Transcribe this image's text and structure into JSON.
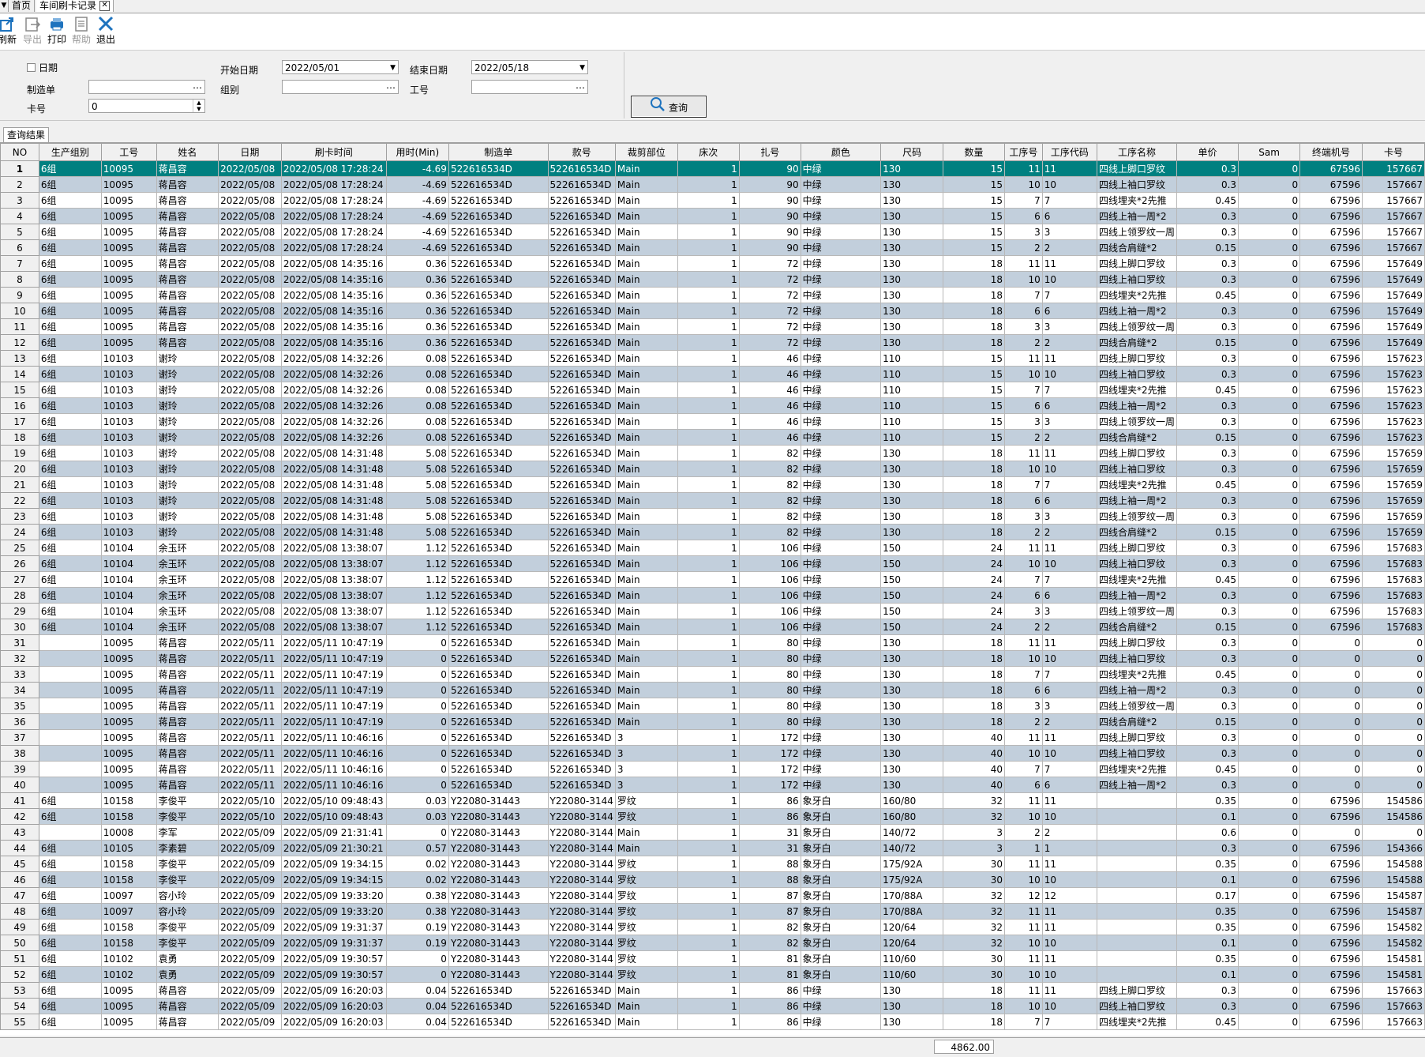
{
  "tabs": [
    {
      "label": "首页"
    },
    {
      "label": "车间刷卡记录"
    }
  ],
  "toolbar": {
    "refresh": "刷新",
    "export": "导出",
    "print": "打印",
    "help": "帮助",
    "exit": "退出"
  },
  "query": {
    "date_check_label": "日期",
    "start_date_label": "开始日期",
    "start_date_value": "2022/05/01",
    "end_date_label": "结束日期",
    "end_date_value": "2022/05/18",
    "order_label": "制造单",
    "order_value": "",
    "group_label": "组别",
    "group_value": "",
    "worker_label": "工号",
    "worker_value": "",
    "card_label": "卡号",
    "card_value": "0",
    "search_button": "查询"
  },
  "results_tab": "查询结果",
  "columns": [
    "NO",
    "生产组别",
    "工号",
    "姓名",
    "日期",
    "刷卡时间",
    "用时(Min)",
    "制造单",
    "款号",
    "裁剪部位",
    "床次",
    "扎号",
    "颜色",
    "尺码",
    "数量",
    "工序号",
    "工序代码",
    "工序名称",
    "单价",
    "Sam",
    "终端机号",
    "卡号"
  ],
  "rows": [
    [
      "1",
      "6组",
      "10095",
      "蒋昌容",
      "2022/05/08",
      "2022/05/08 17:28:24",
      "-4.69",
      "522616534D",
      "522616534D",
      "Main",
      "1",
      "90",
      "中绿",
      "130",
      "15",
      "11",
      "11",
      "四线上脚口罗纹",
      "0.3",
      "0",
      "67596",
      "157667"
    ],
    [
      "2",
      "6组",
      "10095",
      "蒋昌容",
      "2022/05/08",
      "2022/05/08 17:28:24",
      "-4.69",
      "522616534D",
      "522616534D",
      "Main",
      "1",
      "90",
      "中绿",
      "130",
      "15",
      "10",
      "10",
      "四线上袖口罗纹",
      "0.3",
      "0",
      "67596",
      "157667"
    ],
    [
      "3",
      "6组",
      "10095",
      "蒋昌容",
      "2022/05/08",
      "2022/05/08 17:28:24",
      "-4.69",
      "522616534D",
      "522616534D",
      "Main",
      "1",
      "90",
      "中绿",
      "130",
      "15",
      "7",
      "7",
      "四线埋夹*2先推",
      "0.45",
      "0",
      "67596",
      "157667"
    ],
    [
      "4",
      "6组",
      "10095",
      "蒋昌容",
      "2022/05/08",
      "2022/05/08 17:28:24",
      "-4.69",
      "522616534D",
      "522616534D",
      "Main",
      "1",
      "90",
      "中绿",
      "130",
      "15",
      "6",
      "6",
      "四线上袖一周*2",
      "0.3",
      "0",
      "67596",
      "157667"
    ],
    [
      "5",
      "6组",
      "10095",
      "蒋昌容",
      "2022/05/08",
      "2022/05/08 17:28:24",
      "-4.69",
      "522616534D",
      "522616534D",
      "Main",
      "1",
      "90",
      "中绿",
      "130",
      "15",
      "3",
      "3",
      "四线上领罗纹一周",
      "0.3",
      "0",
      "67596",
      "157667"
    ],
    [
      "6",
      "6组",
      "10095",
      "蒋昌容",
      "2022/05/08",
      "2022/05/08 17:28:24",
      "-4.69",
      "522616534D",
      "522616534D",
      "Main",
      "1",
      "90",
      "中绿",
      "130",
      "15",
      "2",
      "2",
      "四线合肩缝*2",
      "0.15",
      "0",
      "67596",
      "157667"
    ],
    [
      "7",
      "6组",
      "10095",
      "蒋昌容",
      "2022/05/08",
      "2022/05/08 14:35:16",
      "0.36",
      "522616534D",
      "522616534D",
      "Main",
      "1",
      "72",
      "中绿",
      "130",
      "18",
      "11",
      "11",
      "四线上脚口罗纹",
      "0.3",
      "0",
      "67596",
      "157649"
    ],
    [
      "8",
      "6组",
      "10095",
      "蒋昌容",
      "2022/05/08",
      "2022/05/08 14:35:16",
      "0.36",
      "522616534D",
      "522616534D",
      "Main",
      "1",
      "72",
      "中绿",
      "130",
      "18",
      "10",
      "10",
      "四线上袖口罗纹",
      "0.3",
      "0",
      "67596",
      "157649"
    ],
    [
      "9",
      "6组",
      "10095",
      "蒋昌容",
      "2022/05/08",
      "2022/05/08 14:35:16",
      "0.36",
      "522616534D",
      "522616534D",
      "Main",
      "1",
      "72",
      "中绿",
      "130",
      "18",
      "7",
      "7",
      "四线埋夹*2先推",
      "0.45",
      "0",
      "67596",
      "157649"
    ],
    [
      "10",
      "6组",
      "10095",
      "蒋昌容",
      "2022/05/08",
      "2022/05/08 14:35:16",
      "0.36",
      "522616534D",
      "522616534D",
      "Main",
      "1",
      "72",
      "中绿",
      "130",
      "18",
      "6",
      "6",
      "四线上袖一周*2",
      "0.3",
      "0",
      "67596",
      "157649"
    ],
    [
      "11",
      "6组",
      "10095",
      "蒋昌容",
      "2022/05/08",
      "2022/05/08 14:35:16",
      "0.36",
      "522616534D",
      "522616534D",
      "Main",
      "1",
      "72",
      "中绿",
      "130",
      "18",
      "3",
      "3",
      "四线上领罗纹一周",
      "0.3",
      "0",
      "67596",
      "157649"
    ],
    [
      "12",
      "6组",
      "10095",
      "蒋昌容",
      "2022/05/08",
      "2022/05/08 14:35:16",
      "0.36",
      "522616534D",
      "522616534D",
      "Main",
      "1",
      "72",
      "中绿",
      "130",
      "18",
      "2",
      "2",
      "四线合肩缝*2",
      "0.15",
      "0",
      "67596",
      "157649"
    ],
    [
      "13",
      "6组",
      "10103",
      "谢玲",
      "2022/05/08",
      "2022/05/08 14:32:26",
      "0.08",
      "522616534D",
      "522616534D",
      "Main",
      "1",
      "46",
      "中绿",
      "110",
      "15",
      "11",
      "11",
      "四线上脚口罗纹",
      "0.3",
      "0",
      "67596",
      "157623"
    ],
    [
      "14",
      "6组",
      "10103",
      "谢玲",
      "2022/05/08",
      "2022/05/08 14:32:26",
      "0.08",
      "522616534D",
      "522616534D",
      "Main",
      "1",
      "46",
      "中绿",
      "110",
      "15",
      "10",
      "10",
      "四线上袖口罗纹",
      "0.3",
      "0",
      "67596",
      "157623"
    ],
    [
      "15",
      "6组",
      "10103",
      "谢玲",
      "2022/05/08",
      "2022/05/08 14:32:26",
      "0.08",
      "522616534D",
      "522616534D",
      "Main",
      "1",
      "46",
      "中绿",
      "110",
      "15",
      "7",
      "7",
      "四线埋夹*2先推",
      "0.45",
      "0",
      "67596",
      "157623"
    ],
    [
      "16",
      "6组",
      "10103",
      "谢玲",
      "2022/05/08",
      "2022/05/08 14:32:26",
      "0.08",
      "522616534D",
      "522616534D",
      "Main",
      "1",
      "46",
      "中绿",
      "110",
      "15",
      "6",
      "6",
      "四线上袖一周*2",
      "0.3",
      "0",
      "67596",
      "157623"
    ],
    [
      "17",
      "6组",
      "10103",
      "谢玲",
      "2022/05/08",
      "2022/05/08 14:32:26",
      "0.08",
      "522616534D",
      "522616534D",
      "Main",
      "1",
      "46",
      "中绿",
      "110",
      "15",
      "3",
      "3",
      "四线上领罗纹一周",
      "0.3",
      "0",
      "67596",
      "157623"
    ],
    [
      "18",
      "6组",
      "10103",
      "谢玲",
      "2022/05/08",
      "2022/05/08 14:32:26",
      "0.08",
      "522616534D",
      "522616534D",
      "Main",
      "1",
      "46",
      "中绿",
      "110",
      "15",
      "2",
      "2",
      "四线合肩缝*2",
      "0.15",
      "0",
      "67596",
      "157623"
    ],
    [
      "19",
      "6组",
      "10103",
      "谢玲",
      "2022/05/08",
      "2022/05/08 14:31:48",
      "5.08",
      "522616534D",
      "522616534D",
      "Main",
      "1",
      "82",
      "中绿",
      "130",
      "18",
      "11",
      "11",
      "四线上脚口罗纹",
      "0.3",
      "0",
      "67596",
      "157659"
    ],
    [
      "20",
      "6组",
      "10103",
      "谢玲",
      "2022/05/08",
      "2022/05/08 14:31:48",
      "5.08",
      "522616534D",
      "522616534D",
      "Main",
      "1",
      "82",
      "中绿",
      "130",
      "18",
      "10",
      "10",
      "四线上袖口罗纹",
      "0.3",
      "0",
      "67596",
      "157659"
    ],
    [
      "21",
      "6组",
      "10103",
      "谢玲",
      "2022/05/08",
      "2022/05/08 14:31:48",
      "5.08",
      "522616534D",
      "522616534D",
      "Main",
      "1",
      "82",
      "中绿",
      "130",
      "18",
      "7",
      "7",
      "四线埋夹*2先推",
      "0.45",
      "0",
      "67596",
      "157659"
    ],
    [
      "22",
      "6组",
      "10103",
      "谢玲",
      "2022/05/08",
      "2022/05/08 14:31:48",
      "5.08",
      "522616534D",
      "522616534D",
      "Main",
      "1",
      "82",
      "中绿",
      "130",
      "18",
      "6",
      "6",
      "四线上袖一周*2",
      "0.3",
      "0",
      "67596",
      "157659"
    ],
    [
      "23",
      "6组",
      "10103",
      "谢玲",
      "2022/05/08",
      "2022/05/08 14:31:48",
      "5.08",
      "522616534D",
      "522616534D",
      "Main",
      "1",
      "82",
      "中绿",
      "130",
      "18",
      "3",
      "3",
      "四线上领罗纹一周",
      "0.3",
      "0",
      "67596",
      "157659"
    ],
    [
      "24",
      "6组",
      "10103",
      "谢玲",
      "2022/05/08",
      "2022/05/08 14:31:48",
      "5.08",
      "522616534D",
      "522616534D",
      "Main",
      "1",
      "82",
      "中绿",
      "130",
      "18",
      "2",
      "2",
      "四线合肩缝*2",
      "0.15",
      "0",
      "67596",
      "157659"
    ],
    [
      "25",
      "6组",
      "10104",
      "余玉环",
      "2022/05/08",
      "2022/05/08 13:38:07",
      "1.12",
      "522616534D",
      "522616534D",
      "Main",
      "1",
      "106",
      "中绿",
      "150",
      "24",
      "11",
      "11",
      "四线上脚口罗纹",
      "0.3",
      "0",
      "67596",
      "157683"
    ],
    [
      "26",
      "6组",
      "10104",
      "余玉环",
      "2022/05/08",
      "2022/05/08 13:38:07",
      "1.12",
      "522616534D",
      "522616534D",
      "Main",
      "1",
      "106",
      "中绿",
      "150",
      "24",
      "10",
      "10",
      "四线上袖口罗纹",
      "0.3",
      "0",
      "67596",
      "157683"
    ],
    [
      "27",
      "6组",
      "10104",
      "余玉环",
      "2022/05/08",
      "2022/05/08 13:38:07",
      "1.12",
      "522616534D",
      "522616534D",
      "Main",
      "1",
      "106",
      "中绿",
      "150",
      "24",
      "7",
      "7",
      "四线埋夹*2先推",
      "0.45",
      "0",
      "67596",
      "157683"
    ],
    [
      "28",
      "6组",
      "10104",
      "余玉环",
      "2022/05/08",
      "2022/05/08 13:38:07",
      "1.12",
      "522616534D",
      "522616534D",
      "Main",
      "1",
      "106",
      "中绿",
      "150",
      "24",
      "6",
      "6",
      "四线上袖一周*2",
      "0.3",
      "0",
      "67596",
      "157683"
    ],
    [
      "29",
      "6组",
      "10104",
      "余玉环",
      "2022/05/08",
      "2022/05/08 13:38:07",
      "1.12",
      "522616534D",
      "522616534D",
      "Main",
      "1",
      "106",
      "中绿",
      "150",
      "24",
      "3",
      "3",
      "四线上领罗纹一周",
      "0.3",
      "0",
      "67596",
      "157683"
    ],
    [
      "30",
      "6组",
      "10104",
      "余玉环",
      "2022/05/08",
      "2022/05/08 13:38:07",
      "1.12",
      "522616534D",
      "522616534D",
      "Main",
      "1",
      "106",
      "中绿",
      "150",
      "24",
      "2",
      "2",
      "四线合肩缝*2",
      "0.15",
      "0",
      "67596",
      "157683"
    ],
    [
      "31",
      "",
      "10095",
      "蒋昌容",
      "2022/05/11",
      "2022/05/11 10:47:19",
      "0",
      "522616534D",
      "522616534D",
      "Main",
      "1",
      "80",
      "中绿",
      "130",
      "18",
      "11",
      "11",
      "四线上脚口罗纹",
      "0.3",
      "0",
      "0",
      "0"
    ],
    [
      "32",
      "",
      "10095",
      "蒋昌容",
      "2022/05/11",
      "2022/05/11 10:47:19",
      "0",
      "522616534D",
      "522616534D",
      "Main",
      "1",
      "80",
      "中绿",
      "130",
      "18",
      "10",
      "10",
      "四线上袖口罗纹",
      "0.3",
      "0",
      "0",
      "0"
    ],
    [
      "33",
      "",
      "10095",
      "蒋昌容",
      "2022/05/11",
      "2022/05/11 10:47:19",
      "0",
      "522616534D",
      "522616534D",
      "Main",
      "1",
      "80",
      "中绿",
      "130",
      "18",
      "7",
      "7",
      "四线埋夹*2先推",
      "0.45",
      "0",
      "0",
      "0"
    ],
    [
      "34",
      "",
      "10095",
      "蒋昌容",
      "2022/05/11",
      "2022/05/11 10:47:19",
      "0",
      "522616534D",
      "522616534D",
      "Main",
      "1",
      "80",
      "中绿",
      "130",
      "18",
      "6",
      "6",
      "四线上袖一周*2",
      "0.3",
      "0",
      "0",
      "0"
    ],
    [
      "35",
      "",
      "10095",
      "蒋昌容",
      "2022/05/11",
      "2022/05/11 10:47:19",
      "0",
      "522616534D",
      "522616534D",
      "Main",
      "1",
      "80",
      "中绿",
      "130",
      "18",
      "3",
      "3",
      "四线上领罗纹一周",
      "0.3",
      "0",
      "0",
      "0"
    ],
    [
      "36",
      "",
      "10095",
      "蒋昌容",
      "2022/05/11",
      "2022/05/11 10:47:19",
      "0",
      "522616534D",
      "522616534D",
      "Main",
      "1",
      "80",
      "中绿",
      "130",
      "18",
      "2",
      "2",
      "四线合肩缝*2",
      "0.15",
      "0",
      "0",
      "0"
    ],
    [
      "37",
      "",
      "10095",
      "蒋昌容",
      "2022/05/11",
      "2022/05/11 10:46:16",
      "0",
      "522616534D",
      "522616534D",
      "3",
      "1",
      "172",
      "中绿",
      "130",
      "40",
      "11",
      "11",
      "四线上脚口罗纹",
      "0.3",
      "0",
      "0",
      "0"
    ],
    [
      "38",
      "",
      "10095",
      "蒋昌容",
      "2022/05/11",
      "2022/05/11 10:46:16",
      "0",
      "522616534D",
      "522616534D",
      "3",
      "1",
      "172",
      "中绿",
      "130",
      "40",
      "10",
      "10",
      "四线上袖口罗纹",
      "0.3",
      "0",
      "0",
      "0"
    ],
    [
      "39",
      "",
      "10095",
      "蒋昌容",
      "2022/05/11",
      "2022/05/11 10:46:16",
      "0",
      "522616534D",
      "522616534D",
      "3",
      "1",
      "172",
      "中绿",
      "130",
      "40",
      "7",
      "7",
      "四线埋夹*2先推",
      "0.45",
      "0",
      "0",
      "0"
    ],
    [
      "40",
      "",
      "10095",
      "蒋昌容",
      "2022/05/11",
      "2022/05/11 10:46:16",
      "0",
      "522616534D",
      "522616534D",
      "3",
      "1",
      "172",
      "中绿",
      "130",
      "40",
      "6",
      "6",
      "四线上袖一周*2",
      "0.3",
      "0",
      "0",
      "0"
    ],
    [
      "41",
      "6组",
      "10158",
      "李俊平",
      "2022/05/10",
      "2022/05/10 09:48:43",
      "0.03",
      "Y22080-31443",
      "Y22080-3144",
      "罗纹",
      "1",
      "86",
      "象牙白",
      "160/80",
      "32",
      "11",
      "11",
      "",
      "0.35",
      "0",
      "67596",
      "154586"
    ],
    [
      "42",
      "6组",
      "10158",
      "李俊平",
      "2022/05/10",
      "2022/05/10 09:48:43",
      "0.03",
      "Y22080-31443",
      "Y22080-3144",
      "罗纹",
      "1",
      "86",
      "象牙白",
      "160/80",
      "32",
      "10",
      "10",
      "",
      "0.1",
      "0",
      "67596",
      "154586"
    ],
    [
      "43",
      "",
      "10008",
      "李军",
      "2022/05/09",
      "2022/05/09 21:31:41",
      "0",
      "Y22080-31443",
      "Y22080-3144",
      "Main",
      "1",
      "31",
      "象牙白",
      "140/72",
      "3",
      "2",
      "2",
      "",
      "0.6",
      "0",
      "0",
      "0"
    ],
    [
      "44",
      "6组",
      "10105",
      "李素碧",
      "2022/05/09",
      "2022/05/09 21:30:21",
      "0.57",
      "Y22080-31443",
      "Y22080-3144",
      "Main",
      "1",
      "31",
      "象牙白",
      "140/72",
      "3",
      "1",
      "1",
      "",
      "0.3",
      "0",
      "67596",
      "154366"
    ],
    [
      "45",
      "6组",
      "10158",
      "李俊平",
      "2022/05/09",
      "2022/05/09 19:34:15",
      "0.02",
      "Y22080-31443",
      "Y22080-3144",
      "罗纹",
      "1",
      "88",
      "象牙白",
      "175/92A",
      "30",
      "11",
      "11",
      "",
      "0.35",
      "0",
      "67596",
      "154588"
    ],
    [
      "46",
      "6组",
      "10158",
      "李俊平",
      "2022/05/09",
      "2022/05/09 19:34:15",
      "0.02",
      "Y22080-31443",
      "Y22080-3144",
      "罗纹",
      "1",
      "88",
      "象牙白",
      "175/92A",
      "30",
      "10",
      "10",
      "",
      "0.1",
      "0",
      "67596",
      "154588"
    ],
    [
      "47",
      "6组",
      "10097",
      "容小玲",
      "2022/05/09",
      "2022/05/09 19:33:20",
      "0.38",
      "Y22080-31443",
      "Y22080-3144",
      "罗纹",
      "1",
      "87",
      "象牙白",
      "170/88A",
      "32",
      "12",
      "12",
      "",
      "0.17",
      "0",
      "67596",
      "154587"
    ],
    [
      "48",
      "6组",
      "10097",
      "容小玲",
      "2022/05/09",
      "2022/05/09 19:33:20",
      "0.38",
      "Y22080-31443",
      "Y22080-3144",
      "罗纹",
      "1",
      "87",
      "象牙白",
      "170/88A",
      "32",
      "11",
      "11",
      "",
      "0.35",
      "0",
      "67596",
      "154587"
    ],
    [
      "49",
      "6组",
      "10158",
      "李俊平",
      "2022/05/09",
      "2022/05/09 19:31:37",
      "0.19",
      "Y22080-31443",
      "Y22080-3144",
      "罗纹",
      "1",
      "82",
      "象牙白",
      "120/64",
      "32",
      "11",
      "11",
      "",
      "0.35",
      "0",
      "67596",
      "154582"
    ],
    [
      "50",
      "6组",
      "10158",
      "李俊平",
      "2022/05/09",
      "2022/05/09 19:31:37",
      "0.19",
      "Y22080-31443",
      "Y22080-3144",
      "罗纹",
      "1",
      "82",
      "象牙白",
      "120/64",
      "32",
      "10",
      "10",
      "",
      "0.1",
      "0",
      "67596",
      "154582"
    ],
    [
      "51",
      "6组",
      "10102",
      "袁勇",
      "2022/05/09",
      "2022/05/09 19:30:57",
      "0",
      "Y22080-31443",
      "Y22080-3144",
      "罗纹",
      "1",
      "81",
      "象牙白",
      "110/60",
      "30",
      "11",
      "11",
      "",
      "0.35",
      "0",
      "67596",
      "154581"
    ],
    [
      "52",
      "6组",
      "10102",
      "袁勇",
      "2022/05/09",
      "2022/05/09 19:30:57",
      "0",
      "Y22080-31443",
      "Y22080-3144",
      "罗纹",
      "1",
      "81",
      "象牙白",
      "110/60",
      "30",
      "10",
      "10",
      "",
      "0.1",
      "0",
      "67596",
      "154581"
    ],
    [
      "53",
      "6组",
      "10095",
      "蒋昌容",
      "2022/05/09",
      "2022/05/09 16:20:03",
      "0.04",
      "522616534D",
      "522616534D",
      "Main",
      "1",
      "86",
      "中绿",
      "130",
      "18",
      "11",
      "11",
      "四线上脚口罗纹",
      "0.3",
      "0",
      "67596",
      "157663"
    ],
    [
      "54",
      "6组",
      "10095",
      "蒋昌容",
      "2022/05/09",
      "2022/05/09 16:20:03",
      "0.04",
      "522616534D",
      "522616534D",
      "Main",
      "1",
      "86",
      "中绿",
      "130",
      "18",
      "10",
      "10",
      "四线上袖口罗纹",
      "0.3",
      "0",
      "67596",
      "157663"
    ],
    [
      "55",
      "6组",
      "10095",
      "蒋昌容",
      "2022/05/09",
      "2022/05/09 16:20:03",
      "0.04",
      "522616534D",
      "522616534D",
      "Main",
      "1",
      "86",
      "中绿",
      "130",
      "18",
      "7",
      "7",
      "四线埋夹*2先推",
      "0.45",
      "0",
      "67596",
      "157663"
    ]
  ],
  "status": {
    "total_quantity": "4862.00"
  },
  "colors": {
    "selected_row": "#008080",
    "alt_row": "#c2cfdc",
    "accent_icon": "#1e73be"
  }
}
